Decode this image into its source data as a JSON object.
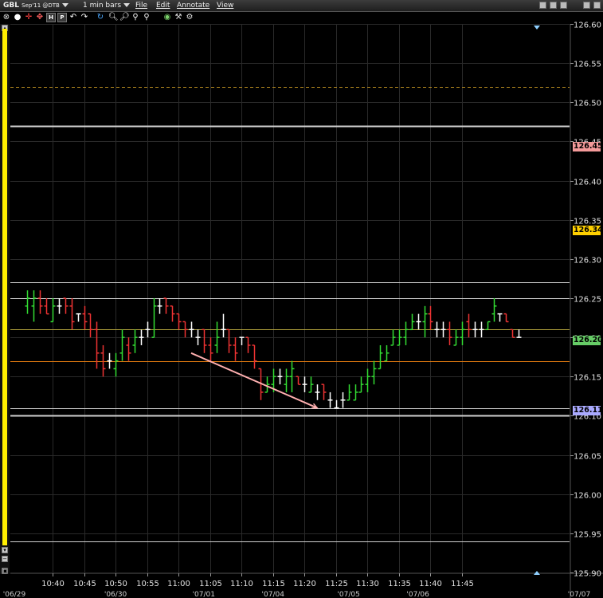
{
  "toolbar": {
    "symbol": "GBL",
    "symbol_detail": "Sep'11 @DTB",
    "interval": "1 min bars",
    "menu_file": "File",
    "menu_edit": "Edit",
    "menu_annotate": "Annotate",
    "menu_view": "View",
    "icon_names": [
      "close-circle-icon",
      "radio-icon",
      "crosshair-icon",
      "move-icon",
      "hold-icon",
      "period-icon",
      "undo-icon",
      "redo-icon",
      "refresh-icon",
      "zoom-in-icon",
      "zoom-out-icon",
      "zoom-reset-icon",
      "zoom-fit-icon",
      "palette-icon",
      "wrench-icon",
      "configure-icon"
    ]
  },
  "price_labels": {
    "ask": "126.45",
    "bid": "126.34",
    "last": "126.20",
    "low": "126.11"
  },
  "colors": {
    "background": "#000000",
    "grid": "#2a2a2a",
    "up_bar": "#33dd33",
    "down_bar": "#ee3333",
    "flat_bar": "#ffffff",
    "horizontal_line": "#d0d0d0",
    "olive_line": "#b6a63e",
    "orange_line": "#e07a10",
    "dashed_line": "#b68a20",
    "trend_line": "#ffb0b0",
    "ask_label": "#f49a9a",
    "bid_label": "#ffd000",
    "last_label": "#66cc66",
    "low_label": "#aaaaff",
    "yellow_bar": "#ffee00"
  },
  "chart_data": {
    "type": "ohlc",
    "interval": "1 min",
    "ylim": [
      125.9,
      126.6
    ],
    "yticks": [
      "126.60",
      "126.55",
      "126.50",
      "126.45",
      "126.40",
      "126.35",
      "126.30",
      "126.25",
      "126.20",
      "126.15",
      "126.10",
      "126.05",
      "126.00",
      "125.95",
      "125.90"
    ],
    "xticks": [
      "10:40",
      "10:45",
      "10:50",
      "10:55",
      "11:00",
      "11:05",
      "11:10",
      "11:15",
      "11:20",
      "11:25",
      "11:30",
      "11:35",
      "11:40",
      "11:45"
    ],
    "date_labels": [
      "'06/29",
      "'06/30",
      "'07/01",
      "'07/04",
      "'07/05",
      "'07/06",
      "'07/07"
    ],
    "grid": true,
    "horizontal_lines": [
      {
        "value": 126.52,
        "style": "dashed",
        "color_key": "dashed_line"
      },
      {
        "value": 126.47,
        "style": "solid-thick",
        "color_key": "horizontal_line"
      },
      {
        "value": 126.27,
        "style": "solid",
        "color_key": "horizontal_line"
      },
      {
        "value": 126.25,
        "style": "solid",
        "color_key": "horizontal_line"
      },
      {
        "value": 126.21,
        "style": "solid",
        "color_key": "olive_line"
      },
      {
        "value": 126.17,
        "style": "solid",
        "color_key": "orange_line"
      },
      {
        "value": 126.11,
        "style": "solid",
        "color_key": "horizontal_line"
      },
      {
        "value": 126.1,
        "style": "solid-thick",
        "color_key": "horizontal_line"
      },
      {
        "value": 125.94,
        "style": "solid",
        "color_key": "horizontal_line"
      }
    ],
    "trend_line": {
      "from": [
        "11:02",
        126.18
      ],
      "to": [
        "11:22",
        126.11
      ]
    },
    "bars": [
      {
        "t": "10:36",
        "o": 126.24,
        "h": 126.26,
        "l": 126.23,
        "c": 126.25
      },
      {
        "t": "10:37",
        "o": 126.24,
        "h": 126.26,
        "l": 126.22,
        "c": 126.25
      },
      {
        "t": "10:38",
        "o": 126.25,
        "h": 126.26,
        "l": 126.23,
        "c": 126.24
      },
      {
        "t": "10:39",
        "o": 126.24,
        "h": 126.25,
        "l": 126.23,
        "c": 126.23
      },
      {
        "t": "10:40",
        "o": 126.22,
        "h": 126.25,
        "l": 126.22,
        "c": 126.24
      },
      {
        "t": "10:41",
        "o": 126.24,
        "h": 126.25,
        "l": 126.23,
        "c": 126.24
      },
      {
        "t": "10:42",
        "o": 126.25,
        "h": 126.25,
        "l": 126.23,
        "c": 126.24
      },
      {
        "t": "10:43",
        "o": 126.24,
        "h": 126.25,
        "l": 126.21,
        "c": 126.22
      },
      {
        "t": "10:44",
        "o": 126.23,
        "h": 126.23,
        "l": 126.22,
        "c": 126.23
      },
      {
        "t": "10:45",
        "o": 126.23,
        "h": 126.24,
        "l": 126.21,
        "c": 126.22
      },
      {
        "t": "10:46",
        "o": 126.23,
        "h": 126.23,
        "l": 126.2,
        "c": 126.21
      },
      {
        "t": "10:47",
        "o": 126.21,
        "h": 126.22,
        "l": 126.16,
        "c": 126.18
      },
      {
        "t": "10:48",
        "o": 126.18,
        "h": 126.19,
        "l": 126.15,
        "c": 126.16
      },
      {
        "t": "10:49",
        "o": 126.17,
        "h": 126.18,
        "l": 126.16,
        "c": 126.17
      },
      {
        "t": "10:50",
        "o": 126.16,
        "h": 126.18,
        "l": 126.15,
        "c": 126.17
      },
      {
        "t": "10:51",
        "o": 126.18,
        "h": 126.21,
        "l": 126.17,
        "c": 126.2
      },
      {
        "t": "10:52",
        "o": 126.19,
        "h": 126.2,
        "l": 126.17,
        "c": 126.18
      },
      {
        "t": "10:53",
        "o": 126.19,
        "h": 126.21,
        "l": 126.18,
        "c": 126.2
      },
      {
        "t": "10:54",
        "o": 126.2,
        "h": 126.21,
        "l": 126.19,
        "c": 126.2
      },
      {
        "t": "10:55",
        "o": 126.21,
        "h": 126.22,
        "l": 126.2,
        "c": 126.21
      },
      {
        "t": "10:56",
        "o": 126.2,
        "h": 126.25,
        "l": 126.2,
        "c": 126.24
      },
      {
        "t": "10:57",
        "o": 126.24,
        "h": 126.25,
        "l": 126.23,
        "c": 126.24
      },
      {
        "t": "10:58",
        "o": 126.25,
        "h": 126.25,
        "l": 126.23,
        "c": 126.24
      },
      {
        "t": "10:59",
        "o": 126.24,
        "h": 126.24,
        "l": 126.22,
        "c": 126.23
      },
      {
        "t": "11:00",
        "o": 126.23,
        "h": 126.23,
        "l": 126.21,
        "c": 126.22
      },
      {
        "t": "11:01",
        "o": 126.22,
        "h": 126.22,
        "l": 126.2,
        "c": 126.21
      },
      {
        "t": "11:02",
        "o": 126.21,
        "h": 126.22,
        "l": 126.2,
        "c": 126.21
      },
      {
        "t": "11:03",
        "o": 126.2,
        "h": 126.21,
        "l": 126.19,
        "c": 126.2
      },
      {
        "t": "11:04",
        "o": 126.21,
        "h": 126.21,
        "l": 126.18,
        "c": 126.19
      },
      {
        "t": "11:05",
        "o": 126.19,
        "h": 126.2,
        "l": 126.17,
        "c": 126.18
      },
      {
        "t": "11:06",
        "o": 126.19,
        "h": 126.22,
        "l": 126.18,
        "c": 126.2
      },
      {
        "t": "11:07",
        "o": 126.21,
        "h": 126.23,
        "l": 126.2,
        "c": 126.21
      },
      {
        "t": "11:08",
        "o": 126.21,
        "h": 126.21,
        "l": 126.18,
        "c": 126.19
      },
      {
        "t": "11:09",
        "o": 126.19,
        "h": 126.2,
        "l": 126.17,
        "c": 126.18
      },
      {
        "t": "11:10",
        "o": 126.2,
        "h": 126.2,
        "l": 126.19,
        "c": 126.2
      },
      {
        "t": "11:11",
        "o": 126.2,
        "h": 126.2,
        "l": 126.18,
        "c": 126.19
      },
      {
        "t": "11:12",
        "o": 126.19,
        "h": 126.19,
        "l": 126.16,
        "c": 126.17
      },
      {
        "t": "11:13",
        "o": 126.16,
        "h": 126.16,
        "l": 126.12,
        "c": 126.13
      },
      {
        "t": "11:14",
        "o": 126.13,
        "h": 126.15,
        "l": 126.13,
        "c": 126.14
      },
      {
        "t": "11:15",
        "o": 126.14,
        "h": 126.16,
        "l": 126.13,
        "c": 126.15
      },
      {
        "t": "11:16",
        "o": 126.15,
        "h": 126.16,
        "l": 126.14,
        "c": 126.15
      },
      {
        "t": "11:17",
        "o": 126.14,
        "h": 126.16,
        "l": 126.13,
        "c": 126.15
      },
      {
        "t": "11:18",
        "o": 126.15,
        "h": 126.17,
        "l": 126.13,
        "c": 126.16
      },
      {
        "t": "11:19",
        "o": 126.15,
        "h": 126.15,
        "l": 126.14,
        "c": 126.14
      },
      {
        "t": "11:20",
        "o": 126.14,
        "h": 126.15,
        "l": 126.13,
        "c": 126.14
      },
      {
        "t": "11:21",
        "o": 126.13,
        "h": 126.15,
        "l": 126.13,
        "c": 126.14
      },
      {
        "t": "11:22",
        "o": 126.13,
        "h": 126.14,
        "l": 126.12,
        "c": 126.13
      },
      {
        "t": "11:23",
        "o": 126.14,
        "h": 126.14,
        "l": 126.12,
        "c": 126.13
      },
      {
        "t": "11:24",
        "o": 126.12,
        "h": 126.13,
        "l": 126.11,
        "c": 126.12
      },
      {
        "t": "11:25",
        "o": 126.11,
        "h": 126.12,
        "l": 126.11,
        "c": 126.11
      },
      {
        "t": "11:26",
        "o": 126.12,
        "h": 126.13,
        "l": 126.11,
        "c": 126.12
      },
      {
        "t": "11:27",
        "o": 126.12,
        "h": 126.14,
        "l": 126.12,
        "c": 126.13
      },
      {
        "t": "11:28",
        "o": 126.12,
        "h": 126.14,
        "l": 126.12,
        "c": 126.13
      },
      {
        "t": "11:29",
        "o": 126.13,
        "h": 126.15,
        "l": 126.13,
        "c": 126.14
      },
      {
        "t": "11:30",
        "o": 126.14,
        "h": 126.16,
        "l": 126.13,
        "c": 126.15
      },
      {
        "t": "11:31",
        "o": 126.15,
        "h": 126.17,
        "l": 126.14,
        "c": 126.16
      },
      {
        "t": "11:32",
        "o": 126.16,
        "h": 126.19,
        "l": 126.16,
        "c": 126.18
      },
      {
        "t": "11:33",
        "o": 126.17,
        "h": 126.19,
        "l": 126.17,
        "c": 126.18
      },
      {
        "t": "11:34",
        "o": 126.19,
        "h": 126.21,
        "l": 126.19,
        "c": 126.2
      },
      {
        "t": "11:35",
        "o": 126.19,
        "h": 126.21,
        "l": 126.19,
        "c": 126.2
      },
      {
        "t": "11:36",
        "o": 126.2,
        "h": 126.22,
        "l": 126.19,
        "c": 126.21
      },
      {
        "t": "11:37",
        "o": 126.21,
        "h": 126.23,
        "l": 126.21,
        "c": 126.22
      },
      {
        "t": "11:38",
        "o": 126.22,
        "h": 126.23,
        "l": 126.21,
        "c": 126.22
      },
      {
        "t": "11:39",
        "o": 126.22,
        "h": 126.24,
        "l": 126.2,
        "c": 126.23
      },
      {
        "t": "11:40",
        "o": 126.23,
        "h": 126.24,
        "l": 126.21,
        "c": 126.22
      },
      {
        "t": "11:41",
        "o": 126.21,
        "h": 126.22,
        "l": 126.2,
        "c": 126.21
      },
      {
        "t": "11:42",
        "o": 126.21,
        "h": 126.22,
        "l": 126.2,
        "c": 126.21
      },
      {
        "t": "11:43",
        "o": 126.21,
        "h": 126.22,
        "l": 126.19,
        "c": 126.2
      },
      {
        "t": "11:44",
        "o": 126.19,
        "h": 126.21,
        "l": 126.19,
        "c": 126.2
      },
      {
        "t": "11:45",
        "o": 126.2,
        "h": 126.22,
        "l": 126.19,
        "c": 126.21
      },
      {
        "t": "11:46",
        "o": 126.22,
        "h": 126.23,
        "l": 126.2,
        "c": 126.21
      },
      {
        "t": "11:47",
        "o": 126.21,
        "h": 126.22,
        "l": 126.2,
        "c": 126.21
      },
      {
        "t": "11:48",
        "o": 126.21,
        "h": 126.22,
        "l": 126.2,
        "c": 126.21
      },
      {
        "t": "11:49",
        "o": 126.21,
        "h": 126.22,
        "l": 126.21,
        "c": 126.22
      },
      {
        "t": "11:50",
        "o": 126.23,
        "h": 126.25,
        "l": 126.22,
        "c": 126.24
      },
      {
        "t": "11:51",
        "o": 126.23,
        "h": 126.23,
        "l": 126.22,
        "c": 126.23
      },
      {
        "t": "11:52",
        "o": 126.23,
        "h": 126.23,
        "l": 126.22,
        "c": 126.22
      },
      {
        "t": "11:53",
        "o": 126.21,
        "h": 126.21,
        "l": 126.2,
        "c": 126.2
      },
      {
        "t": "11:54",
        "o": 126.2,
        "h": 126.21,
        "l": 126.2,
        "c": 126.2
      }
    ]
  }
}
